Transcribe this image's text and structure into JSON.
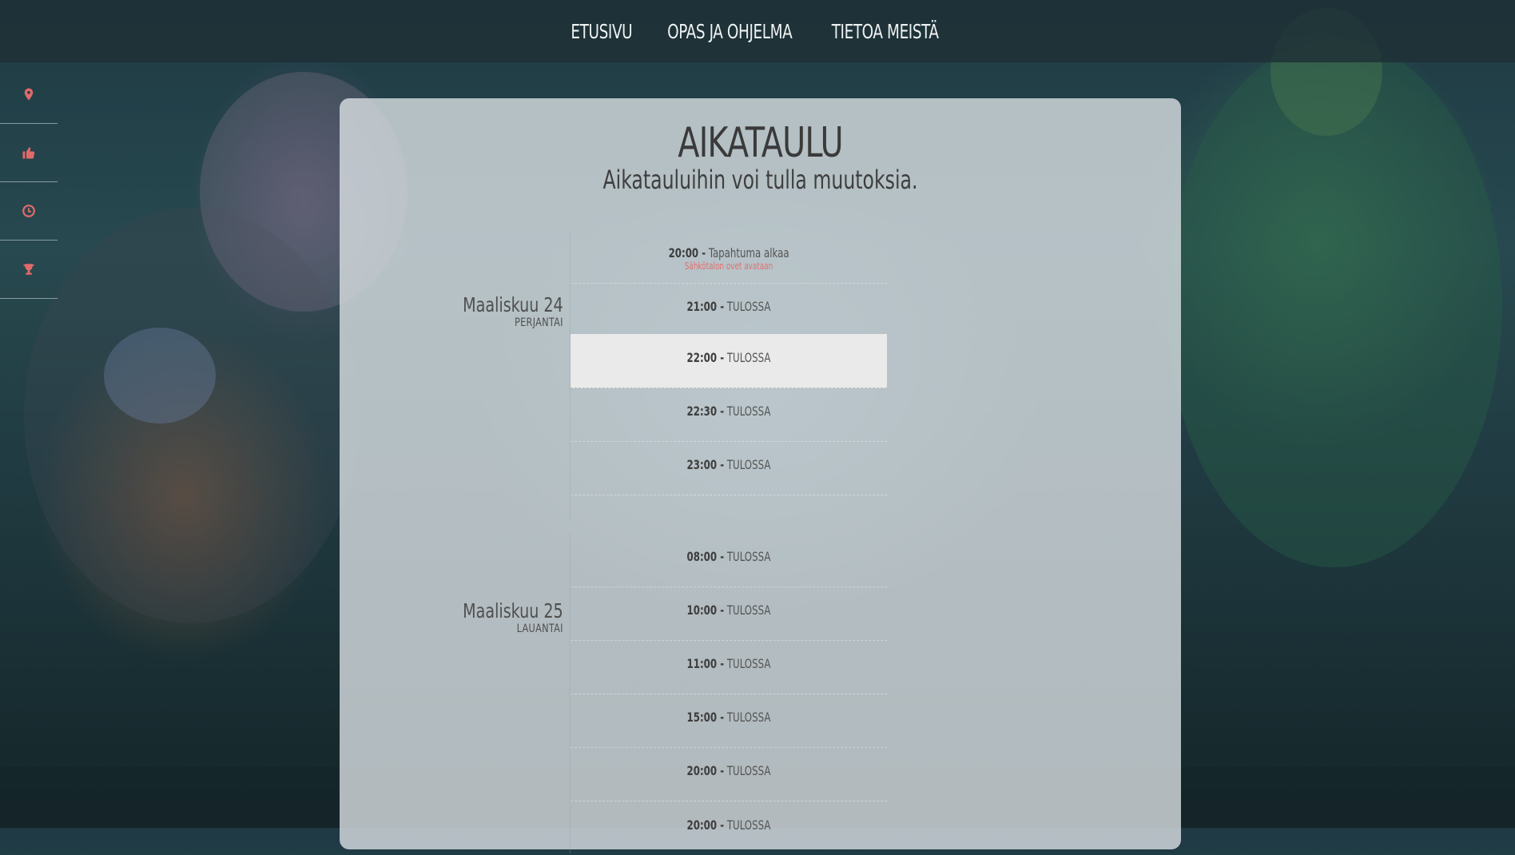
{
  "nav": {
    "items": [
      {
        "label": "ETUSIVU"
      },
      {
        "label": "OPAS JA OHJELMA"
      },
      {
        "label": "TIETOA MEISTÄ"
      }
    ]
  },
  "sidebar": {
    "icons": [
      "map-marker-icon",
      "thumbs-up-icon",
      "clock-icon",
      "trophy-icon"
    ],
    "icon_color": "#e06a6a"
  },
  "schedule": {
    "title": "AIKATAULU",
    "subtitle": "Aikatauluihin voi tulla muutoksia.",
    "days": [
      {
        "date": "Maaliskuu 24",
        "weekday": "PERJANTAI",
        "events": [
          {
            "time": "20:00 -",
            "label": "Tapahtuma alkaa",
            "note": "Sähkötalon ovet avataan"
          },
          {
            "time": "21:00 -",
            "label": "TULOSSA"
          },
          {
            "time": "22:00 -",
            "label": "TULOSSA",
            "highlighted": true
          },
          {
            "time": "22:30 -",
            "label": "TULOSSA"
          },
          {
            "time": "23:00 -",
            "label": "TULOSSA"
          }
        ]
      },
      {
        "date": "Maaliskuu 25",
        "weekday": "LAUANTAI",
        "events": [
          {
            "time": "08:00 -",
            "label": "TULOSSA"
          },
          {
            "time": "10:00 -",
            "label": "TULOSSA"
          },
          {
            "time": "11:00 -",
            "label": "TULOSSA"
          },
          {
            "time": "15:00 -",
            "label": "TULOSSA"
          },
          {
            "time": "20:00 -",
            "label": "TULOSSA"
          },
          {
            "time": "20:00 -",
            "label": "TULOSSA"
          }
        ]
      }
    ]
  }
}
